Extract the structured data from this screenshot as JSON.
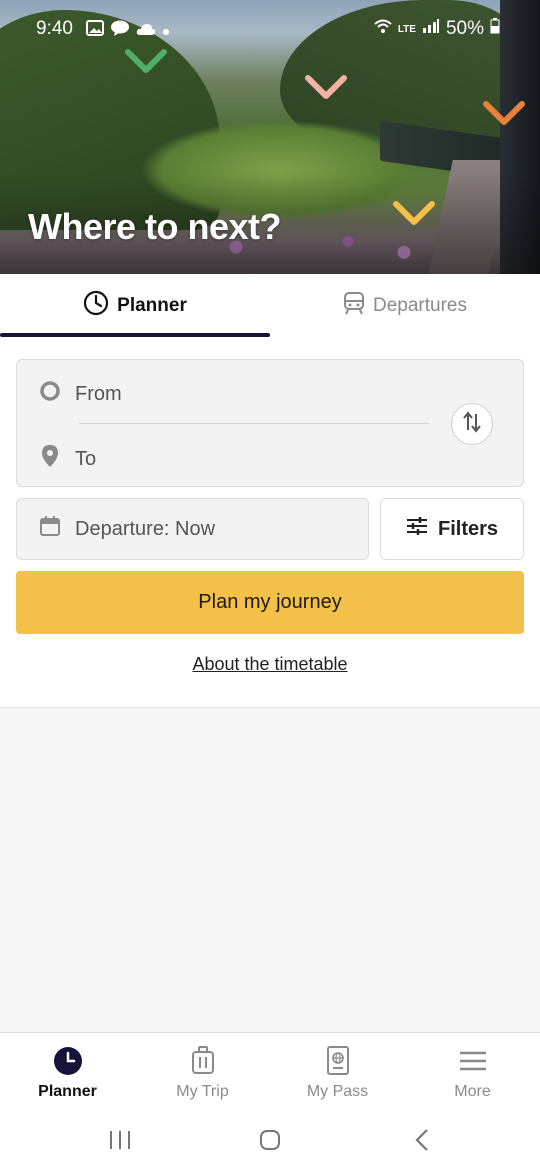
{
  "status_bar": {
    "time": "9:40",
    "network": "LTE",
    "battery": "50%"
  },
  "hero": {
    "title": "Where to next?"
  },
  "tabs": [
    {
      "label": "Planner",
      "icon": "clock-icon",
      "active": true
    },
    {
      "label": "Departures",
      "icon": "train-icon",
      "active": false
    }
  ],
  "form": {
    "from_placeholder": "From",
    "to_placeholder": "To",
    "departure_label": "Departure: Now",
    "filters_label": "Filters",
    "plan_button": "Plan my journey",
    "about_link": "About the timetable"
  },
  "bottom_nav": [
    {
      "label": "Planner",
      "icon": "clock-icon",
      "active": true
    },
    {
      "label": "My Trip",
      "icon": "luggage-icon",
      "active": false
    },
    {
      "label": "My Pass",
      "icon": "passport-icon",
      "active": false
    },
    {
      "label": "More",
      "icon": "menu-icon",
      "active": false
    }
  ],
  "colors": {
    "accent": "#f3c04a",
    "tab_indicator": "#14143a",
    "chevron_green": "#4fae6a",
    "chevron_pink": "#f0b3a4",
    "chevron_orange": "#e8823a",
    "chevron_yellow": "#f3c04a"
  }
}
